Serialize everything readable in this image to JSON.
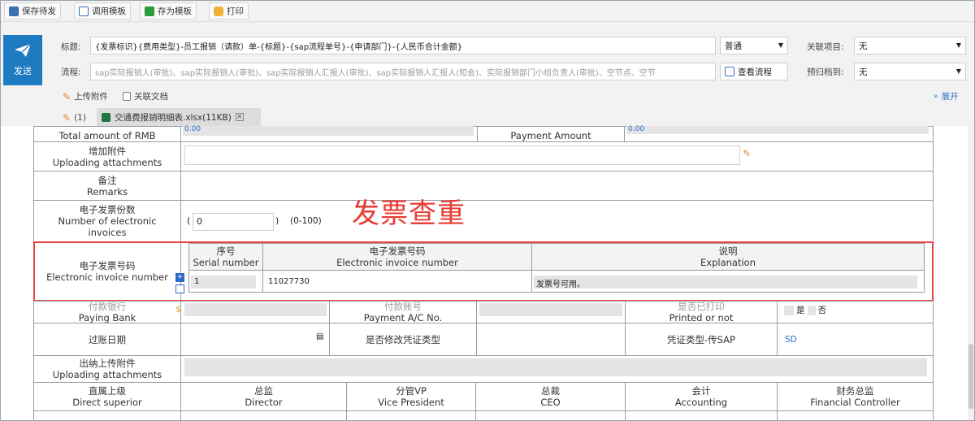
{
  "toolbar": {
    "save_draft": "保存待发",
    "load_template": "调用模板",
    "save_template": "存为模板",
    "print": "打印"
  },
  "header": {
    "send_label": "发送",
    "title_label": "标题:",
    "title_value": "{发票标识}{费用类型}-员工报销（请款）单-{标题}-{sap流程单号}-{申请部门}-{人民币合计金额}",
    "priority_value": "普通",
    "related_project_label": "关联项目:",
    "related_project_value": "无",
    "flow_label": "流程:",
    "flow_placeholder": "sap实际报销人(审批)、sap实际报销人(审批)、sap实际报销人汇报人(审批)、sap实际报销人汇报人(知会)、实际报销部门小组负责人(审批)、空节点、空节",
    "view_flow": "查看流程",
    "archive_label": "预归档到:",
    "archive_value": "无",
    "upload_attach": "上传附件",
    "related_doc": "关联文档",
    "attach_count": "(1)",
    "attach_file": "交通费报销明细表.xlsx(11KB)",
    "expand": "展开"
  },
  "form": {
    "total_rmb_label": "Total amount of RMB",
    "total_rmb_value": "0.00",
    "payment_amount_label": "Payment Amount",
    "payment_amount_value": "0.00",
    "add_attach_cn": "增加附件",
    "add_attach_en": "Uploading attachments",
    "remarks_cn": "备注",
    "remarks_en": "Remarks",
    "einv_count_cn": "电子发票份数",
    "einv_count_en_1": "Number of electronic",
    "einv_count_en_2": "invoices",
    "einv_count_value": "0",
    "paren_open": "(",
    "paren_close": ")",
    "einv_count_range": "(0-100)",
    "einv_no_cn": "电子发票号码",
    "einv_no_en": "Electronic invoice number",
    "col_serial_cn": "序号",
    "col_serial_en": "Serial number",
    "col_einv_cn": "电子发票号码",
    "col_einv_en": "Electronic invoice number",
    "col_expl_cn": "说明",
    "col_expl_en": "Explanation",
    "row_serial": "1",
    "row_einv": "11027730",
    "row_expl": "发票号可用。",
    "paying_bank_cn": "付款银行",
    "paying_bank_en": "Paying Bank",
    "payment_ac_cn": "付款账号",
    "payment_ac_en": "Payment A/C No.",
    "printed_cn": "是否已打印",
    "printed_en": "Printed or not",
    "opt_yes": "是",
    "opt_no": "否",
    "post_date": "过账日期",
    "modify_voucher": "是否修改凭证类型",
    "voucher_type": "凭证类型-传SAP",
    "voucher_value": "SD",
    "cashier_attach_cn": "出纳上传附件",
    "cashier_attach_en": "Uploading attachments",
    "sup_cn": "直属上级",
    "sup_en": "Direct superior",
    "dir_cn": "总监",
    "dir_en": "Director",
    "vp_cn": "分管VP",
    "vp_en": "Vice President",
    "ceo_cn": "总裁",
    "ceo_en": "CEO",
    "acc_cn": "会计",
    "acc_en": "Accounting",
    "fc_cn": "财务总监",
    "fc_en": "Financial Controller"
  },
  "annotation": {
    "label": "发票查重",
    "color": "#e83a33"
  },
  "colors": {
    "send_bg": "#1f7bc1",
    "highlight": "#e94545"
  }
}
